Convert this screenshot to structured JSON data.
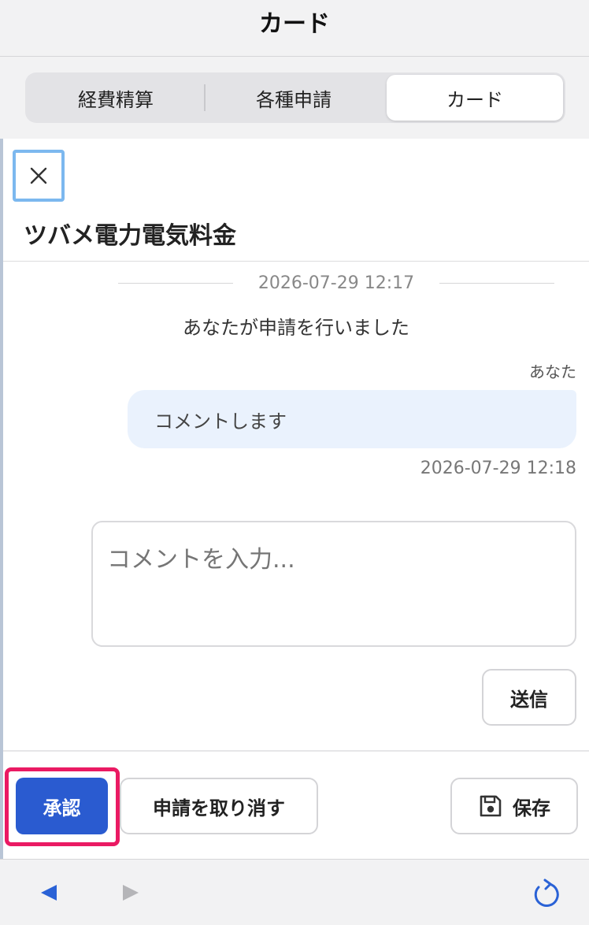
{
  "titlebar": {
    "title": "カード"
  },
  "segments": {
    "items": [
      {
        "label": "経費精算"
      },
      {
        "label": "各種申請"
      },
      {
        "label": "カード"
      }
    ],
    "active_index": 2
  },
  "detail": {
    "close_icon": "close-icon",
    "title": "ツバメ電力電気料金",
    "event": {
      "timestamp": "2026-07-29 12:17",
      "text": "あなたが申請を行いました"
    },
    "comment": {
      "author": "あなた",
      "text": "コメントします",
      "timestamp": "2026-07-29 12:18"
    },
    "comment_input": {
      "placeholder": "コメントを入力...",
      "value": ""
    },
    "send_label": "送信"
  },
  "actions": {
    "approve_label": "承認",
    "cancel_label": "申請を取り消す",
    "save_label": "保存",
    "save_icon": "floppy-disk-icon"
  },
  "toolbar": {
    "back_icon": "back-arrow-icon",
    "forward_icon": "forward-arrow-icon",
    "reload_icon": "reload-icon"
  },
  "colors": {
    "accent": "#2a5bd0",
    "highlight": "#ea1a63",
    "focus_ring": "#7cb8ef",
    "bubble_bg": "#eaf2fd"
  }
}
